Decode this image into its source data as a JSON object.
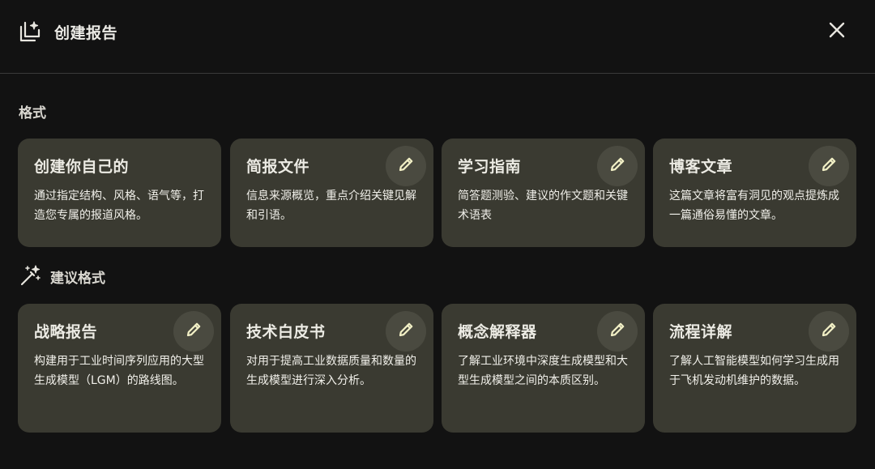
{
  "header": {
    "title": "创建报告",
    "title_icon": "stacked-sparkle-icon",
    "close_icon": "close-icon"
  },
  "sections": {
    "format_label": "格式",
    "suggested_label": "建议格式",
    "suggested_icon": "magic-wand-icon"
  },
  "formats": [
    {
      "title": "创建你自己的",
      "desc": "通过指定结构、风格、语气等，打造您专属的报道风格。",
      "editable": false
    },
    {
      "title": "简报文件",
      "desc": "信息来源概览，重点介绍关键见解和引语。",
      "editable": true
    },
    {
      "title": "学习指南",
      "desc": "简答题测验、建议的作文题和关键术语表",
      "editable": true
    },
    {
      "title": "博客文章",
      "desc": "这篇文章将富有洞见的观点提炼成一篇通俗易懂的文章。",
      "editable": true
    }
  ],
  "suggested": [
    {
      "title": "战略报告",
      "desc": "构建用于工业时间序列应用的大型生成模型（LGM）的路线图。",
      "editable": true
    },
    {
      "title": "技术白皮书",
      "desc": "对用于提高工业数据质量和数量的生成模型进行深入分析。",
      "editable": true
    },
    {
      "title": "概念解释器",
      "desc": "了解工业环境中深度生成模型和大型生成模型之间的本质区别。",
      "editable": true
    },
    {
      "title": "流程详解",
      "desc": "了解人工智能模型如何学习生成用于飞机发动机维护的数据。",
      "editable": true
    }
  ],
  "colors": {
    "background": "#121212",
    "card": "#3a3a31",
    "edit_button": "#4a4a40",
    "edit_icon": "#f2f0c6",
    "text": "#ecebe4"
  },
  "icons": {
    "edit": "pencil-icon"
  }
}
